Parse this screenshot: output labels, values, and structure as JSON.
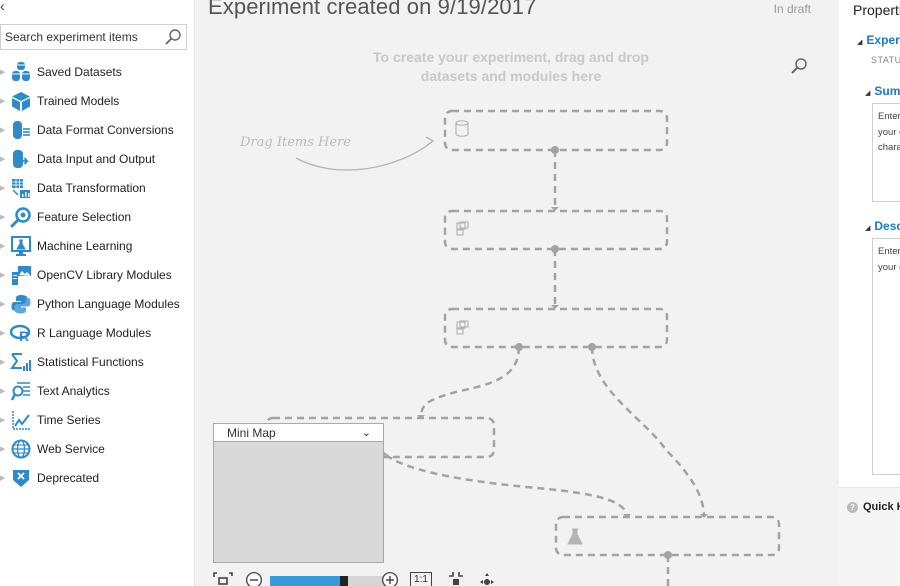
{
  "palette": {
    "collapse_glyph": "‹",
    "search_placeholder": "Search experiment items",
    "items": [
      {
        "label": "Saved Datasets",
        "icon": "datasets-icon"
      },
      {
        "label": "Trained Models",
        "icon": "cube-icon"
      },
      {
        "label": "Data Format Conversions",
        "icon": "data-format-icon"
      },
      {
        "label": "Data Input and Output",
        "icon": "data-io-icon"
      },
      {
        "label": "Data Transformation",
        "icon": "data-transform-icon"
      },
      {
        "label": "Feature Selection",
        "icon": "feature-selection-icon"
      },
      {
        "label": "Machine Learning",
        "icon": "machine-learning-icon"
      },
      {
        "label": "OpenCV Library Modules",
        "icon": "opencv-icon"
      },
      {
        "label": "Python Language Modules",
        "icon": "python-icon"
      },
      {
        "label": "R Language Modules",
        "icon": "r-language-icon"
      },
      {
        "label": "Statistical Functions",
        "icon": "statistics-icon"
      },
      {
        "label": "Text Analytics",
        "icon": "text-analytics-icon"
      },
      {
        "label": "Time Series",
        "icon": "time-series-icon"
      },
      {
        "label": "Web Service",
        "icon": "globe-icon"
      },
      {
        "label": "Deprecated",
        "icon": "deprecated-icon"
      }
    ]
  },
  "canvas": {
    "title": "Experiment created on 9/19/2017",
    "status": "In draft",
    "hint": "To create your experiment, drag and drop datasets and modules here",
    "drag_hint": "Drag Items Here",
    "minimap_label": "Mini Map",
    "zoom_level_fraction": 0.6,
    "zoom_one_to_one": "1:1"
  },
  "properties": {
    "title": "Properties",
    "experiment_section": "Experiment",
    "status_label": "STATUS",
    "summary_section": "Summary",
    "summary_placeholder": "Enter a few sentences\nyour experiment (up to\ncharacters)",
    "description_section": "Description",
    "description_placeholder": "Enter a description\nyour experiment",
    "quick_help": "Quick Help"
  },
  "colors": {
    "accent": "#1a7bbf",
    "icon_blue": "#2e8ac9",
    "zoom_fill": "#3a9ad9",
    "flow_gray": "#a3a3a3"
  }
}
